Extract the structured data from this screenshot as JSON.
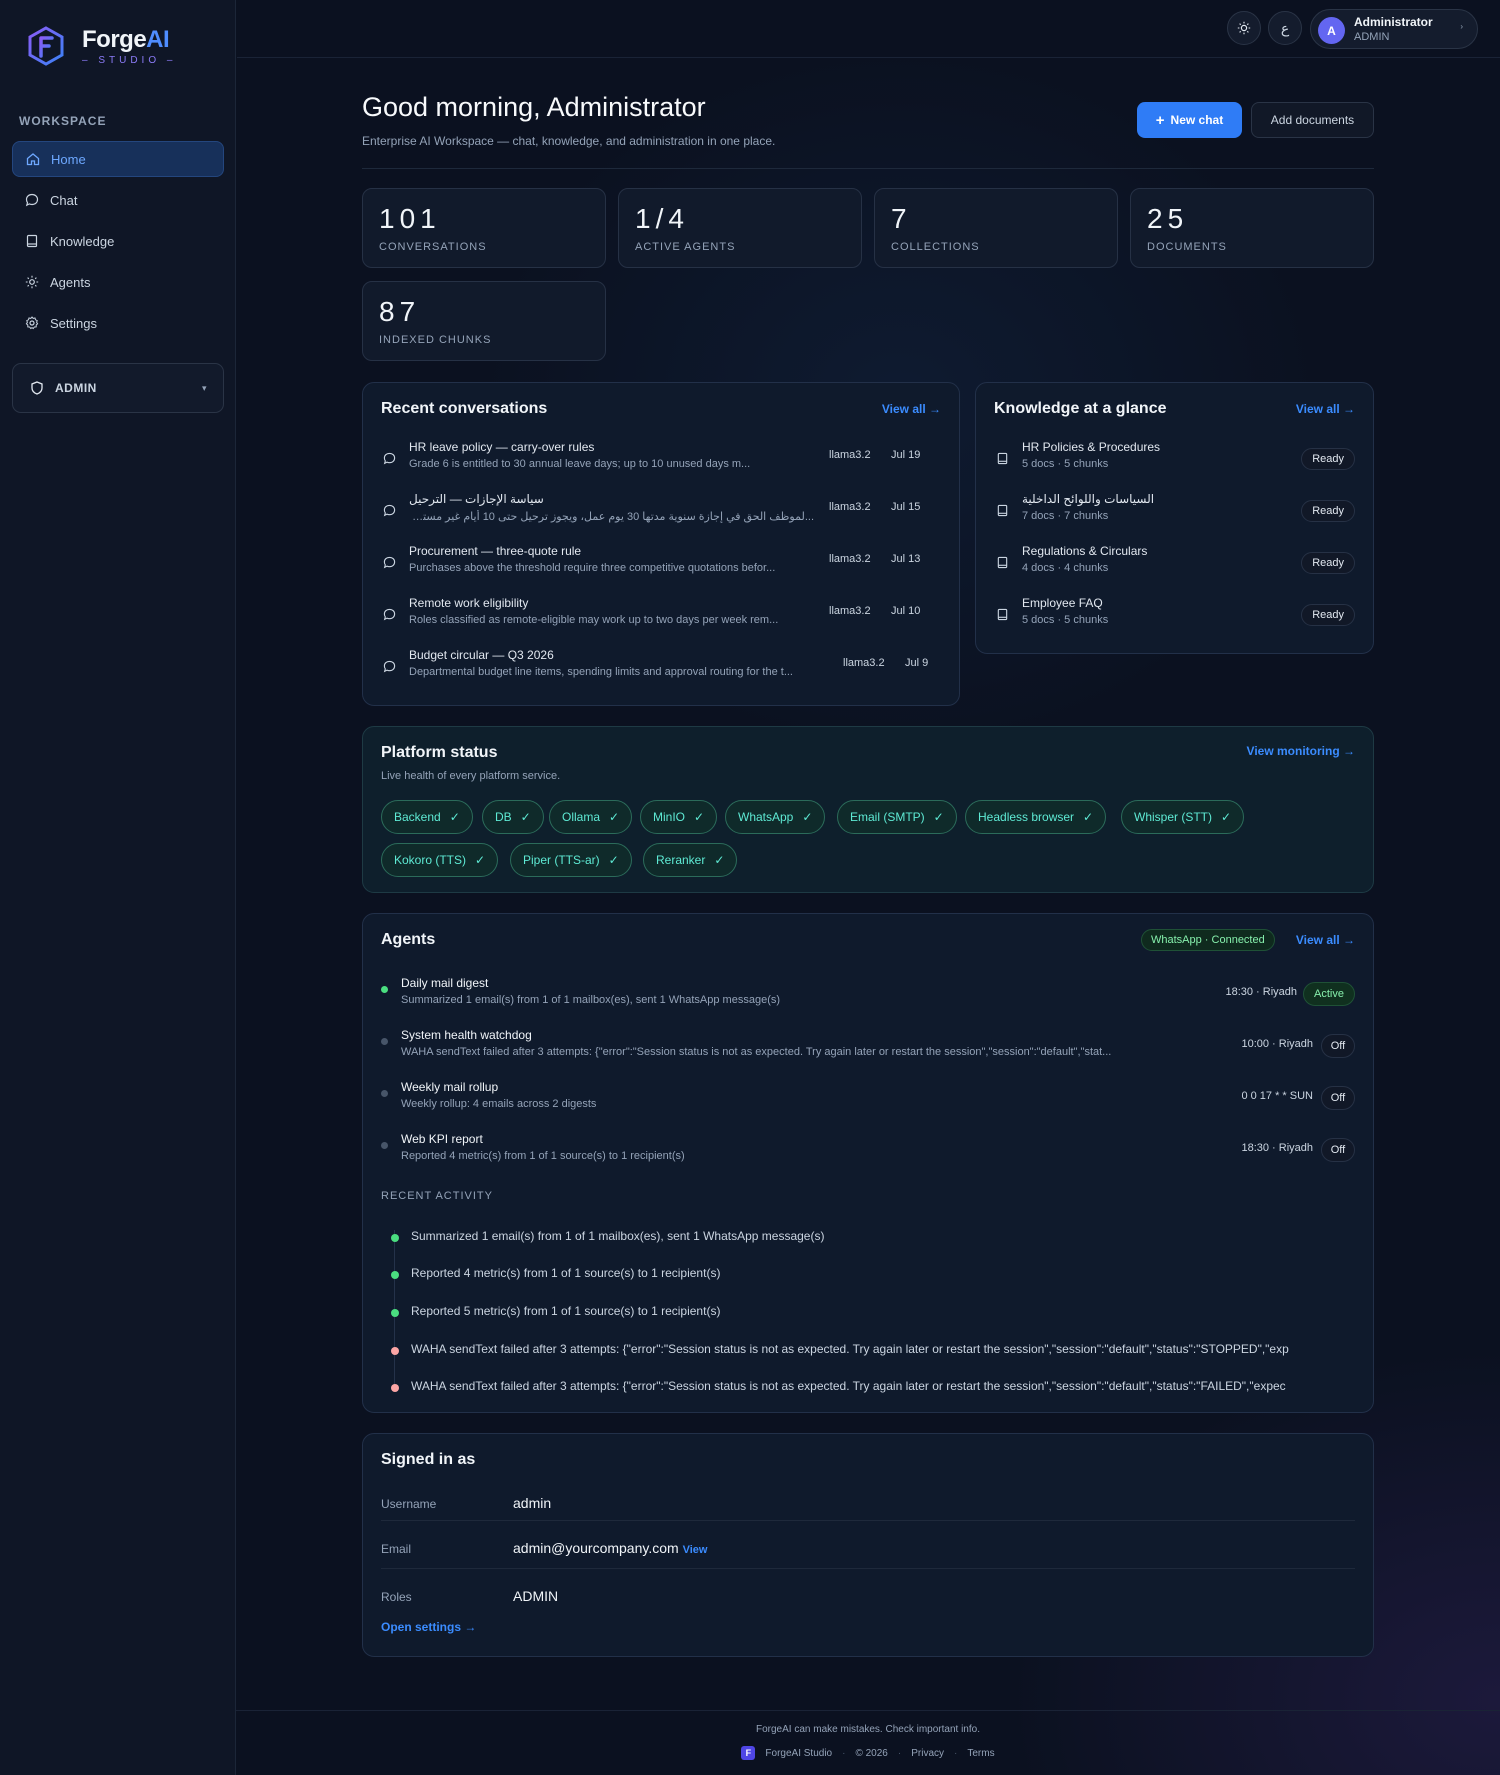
{
  "brand": {
    "name_main": "Forge",
    "name_accent": "AI",
    "sub": "– STUDIO –"
  },
  "sidebar": {
    "section_label": "WORKSPACE",
    "items": [
      {
        "label": "Home",
        "icon": "home-icon"
      },
      {
        "label": "Chat",
        "icon": "chat-icon"
      },
      {
        "label": "Knowledge",
        "icon": "book-icon"
      },
      {
        "label": "Agents",
        "icon": "agents-icon"
      },
      {
        "label": "Settings",
        "icon": "gear-icon"
      }
    ],
    "admin_label": "ADMIN"
  },
  "topbar": {
    "lang_label": "ع",
    "user_name": "Administrator",
    "user_role": "ADMIN",
    "avatar_letter": "A"
  },
  "header": {
    "title": "Good morning, Administrator",
    "subtitle": "Enterprise AI Workspace — chat, knowledge, and administration in one place.",
    "new_chat": "New chat",
    "add_docs": "Add documents"
  },
  "stats": [
    {
      "value": "101",
      "label": "CONVERSATIONS"
    },
    {
      "value": "1/4",
      "label": "ACTIVE AGENTS"
    },
    {
      "value": "7",
      "label": "COLLECTIONS"
    },
    {
      "value": "25",
      "label": "DOCUMENTS"
    },
    {
      "value": "87",
      "label": "INDEXED CHUNKS"
    }
  ],
  "recent": {
    "title": "Recent conversations",
    "view_all": "View all →",
    "items": [
      {
        "title": "HR leave policy — carry-over rules",
        "sub": "Grade 6 is entitled to 30 annual leave days; up to 10 unused days m...",
        "model": "llama3.2",
        "date": "Jul 19"
      },
      {
        "title": "سياسة الإجازات — الترحيل",
        "sub": "...لموظف الحق في إجازة سنوية مدتها 30 يوم عمل، ويجوز ترحيل حتى 10 أيام غير مستخدمة إلى السنة التالية بموافقة المدير",
        "model": "llama3.2",
        "date": "Jul 15"
      },
      {
        "title": "Procurement — three-quote rule",
        "sub": "Purchases above the threshold require three competitive quotations befor...",
        "model": "llama3.2",
        "date": "Jul 13"
      },
      {
        "title": "Remote work eligibility",
        "sub": "Roles classified as remote-eligible may work up to two days per week rem...",
        "model": "llama3.2",
        "date": "Jul 10"
      },
      {
        "title": "Budget circular — Q3 2026",
        "sub": "Departmental budget line items, spending limits and approval routing for the t...",
        "model": "llama3.2",
        "date": "Jul 9"
      }
    ]
  },
  "knowledge": {
    "title": "Knowledge at a glance",
    "view_all": "View all →",
    "items": [
      {
        "title": "HR Policies & Procedures",
        "sub": "5 docs · 5 chunks",
        "status": "Ready"
      },
      {
        "title": "السياسات واللوائح الداخلية",
        "sub": "7 docs · 7 chunks",
        "status": "Ready"
      },
      {
        "title": "Regulations & Circulars",
        "sub": "4 docs · 4 chunks",
        "status": "Ready"
      },
      {
        "title": "Employee FAQ",
        "sub": "5 docs · 5 chunks",
        "status": "Ready"
      }
    ]
  },
  "platform": {
    "title": "Platform status",
    "subtitle": "Live health of every platform service.",
    "view": "View monitoring →",
    "services": [
      "Backend",
      "DB",
      "Ollama",
      "MinIO",
      "WhatsApp",
      "Email (SMTP)",
      "Headless browser",
      "Whisper (STT)",
      "Kokoro (TTS)",
      "Piper (TTS-ar)",
      "Reranker"
    ]
  },
  "agents": {
    "title": "Agents",
    "badge": "WhatsApp · Connected",
    "view_all": "View all →",
    "items": [
      {
        "title": "Daily mail digest",
        "sub": "Summarized 1 email(s) from 1 of 1 mailbox(es), sent 1 WhatsApp message(s)",
        "sched": "18:30 · Riyadh",
        "state": "Active",
        "on": true
      },
      {
        "title": "System health watchdog",
        "sub": "WAHA sendText failed after 3 attempts: {\"error\":\"Session status is not as expected. Try again later or restart the session\",\"session\":\"default\",\"stat...",
        "sched": "10:00 · Riyadh",
        "state": "Off",
        "on": false
      },
      {
        "title": "Weekly mail rollup",
        "sub": "Weekly rollup: 4 emails across 2 digests",
        "sched": "0 0 17 * * SUN",
        "state": "Off",
        "on": false
      },
      {
        "title": "Web KPI report",
        "sub": "Reported 4 metric(s) from 1 of 1 source(s) to 1 recipient(s)",
        "sched": "18:30 · Riyadh",
        "state": "Off",
        "on": false
      }
    ],
    "activity_label": "RECENT ACTIVITY",
    "activity": [
      {
        "text": "Summarized 1 email(s) from 1 of 1 mailbox(es), sent 1 WhatsApp message(s)",
        "ok": true
      },
      {
        "text": "Reported 4 metric(s) from 1 of 1 source(s) to 1 recipient(s)",
        "ok": true
      },
      {
        "text": "Reported 5 metric(s) from 1 of 1 source(s) to 1 recipient(s)",
        "ok": true
      },
      {
        "text": "WAHA sendText failed after 3 attempts: {\"error\":\"Session status is not as expected. Try again later or restart the session\",\"session\":\"default\",\"status\":\"STOPPED\",\"exp",
        "ok": false
      },
      {
        "text": "WAHA sendText failed after 3 attempts: {\"error\":\"Session status is not as expected. Try again later or restart the session\",\"session\":\"default\",\"status\":\"FAILED\",\"expec",
        "ok": false
      }
    ]
  },
  "signed_in": {
    "title": "Signed in as",
    "username_label": "Username",
    "username": "admin",
    "email_label": "Email",
    "email": "admin@yourcompany.com",
    "email_view": "View",
    "roles_label": "Roles",
    "roles": "ADMIN",
    "open_settings": "Open settings →"
  },
  "footer": {
    "disclaimer": "ForgeAI can make mistakes. Check important info.",
    "brand": "ForgeAI Studio",
    "copyright": "© 2026",
    "privacy": "Privacy",
    "terms": "Terms"
  },
  "colors": {
    "accent": "#2f7cf6",
    "ok": "#4ade80",
    "bad": "#fca5a5",
    "chip": "#5eead4"
  }
}
